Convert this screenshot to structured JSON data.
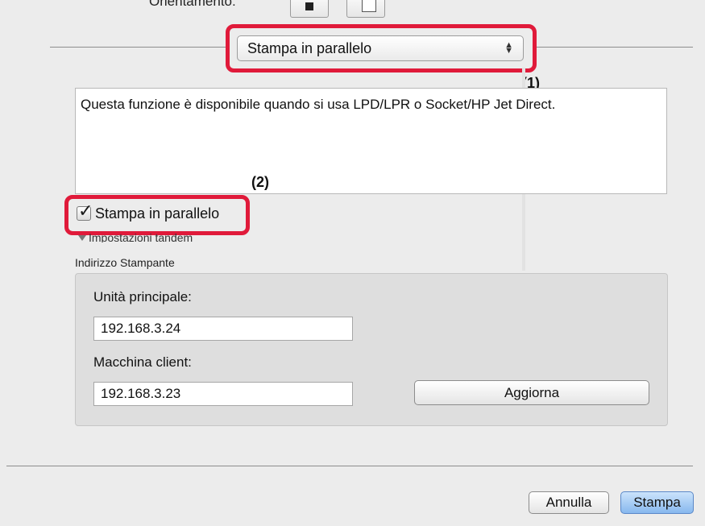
{
  "top": {
    "cut_label": "Orientamento:"
  },
  "popup": {
    "selected": "Stampa in parallelo"
  },
  "callouts": {
    "one": "(1)",
    "two": "(2)"
  },
  "description": "Questa funzione è disponibile quando si usa LPD/LPR o Socket/HP Jet Direct.",
  "checkbox": {
    "label": "Stampa in parallelo",
    "checked": true
  },
  "tandem_settings_label": "Impostazioni tandem",
  "address_section": {
    "title": "Indirizzo Stampante",
    "main_label": "Unità principale:",
    "main_value": "192.168.3.24",
    "client_label": "Macchina client:",
    "client_value": "192.168.3.23",
    "update_button": "Aggiorna"
  },
  "footer": {
    "cancel": "Annulla",
    "print": "Stampa"
  }
}
